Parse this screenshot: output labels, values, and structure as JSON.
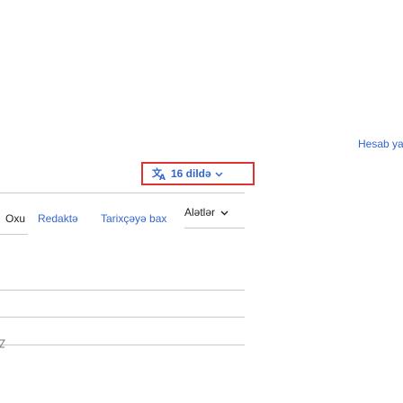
{
  "header": {
    "account_link": "Hesab yar"
  },
  "language_button": {
    "label": "16 dildə",
    "icon": "translate-icon"
  },
  "tabs": {
    "read": "Oxu",
    "edit": "Redaktə",
    "history": "Tarixçəyə bax",
    "tools": "Alətlər"
  },
  "colors": {
    "link": "#3366cc",
    "text": "#202122",
    "highlight_border": "#dd3333",
    "divider": "#c8ccd1"
  }
}
